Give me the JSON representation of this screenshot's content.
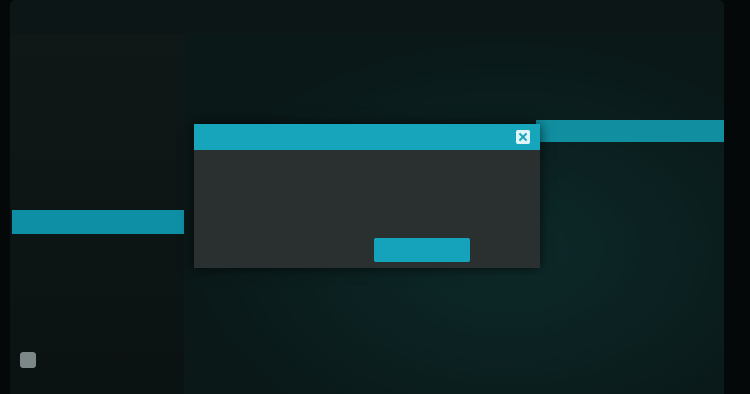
{
  "app": {
    "title": "",
    "clock": ""
  },
  "sidebar": {
    "items": [
      {
        "label": ""
      },
      {
        "label": ""
      },
      {
        "label": ""
      },
      {
        "label": ""
      },
      {
        "label": ""
      },
      {
        "label": ""
      },
      {
        "label": ""
      }
    ],
    "active_index": 5,
    "footer_label": ""
  },
  "main": {
    "heading": "",
    "rows": [
      {
        "label": "",
        "value": ""
      },
      {
        "label": "",
        "value": ""
      },
      {
        "label": "",
        "value": ""
      }
    ],
    "footnote": ""
  },
  "dialog": {
    "title": "",
    "body": "",
    "cancel_label": "",
    "confirm_label": ""
  },
  "colors": {
    "accent": "#16a5bb",
    "highlight": "#0e8fa5",
    "dialog_bg": "#2a2f2f",
    "background": "#0a1414"
  }
}
